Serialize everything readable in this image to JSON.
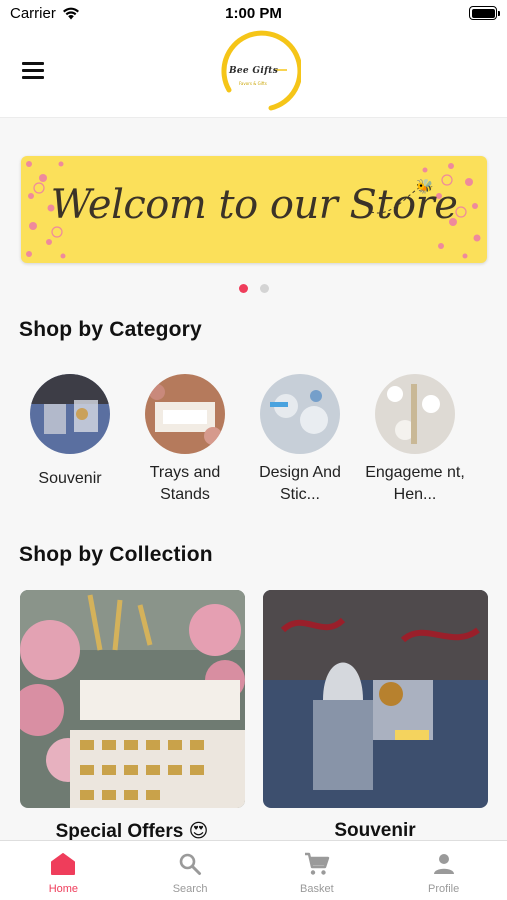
{
  "status_bar": {
    "carrier": "Carrier",
    "time": "1:00 PM"
  },
  "header": {
    "logo_text": "Bee Gifts"
  },
  "banner": {
    "text": "Welcom to our Store",
    "bg_color": "#fbe05a",
    "active_slide": 1,
    "slide_count": 2
  },
  "categories": {
    "title": "Shop by Category",
    "items": [
      {
        "label": "Souvenir"
      },
      {
        "label": "Trays and Stands"
      },
      {
        "label": "Design And Stic..."
      },
      {
        "label": "Engageme nt, Hen..."
      }
    ]
  },
  "collections": {
    "title": "Shop by Collection",
    "items": [
      {
        "label": "Special Offers 😍"
      },
      {
        "label": "Souvenir"
      }
    ]
  },
  "tabbar": {
    "items": [
      {
        "label": "Home",
        "icon": "home-icon",
        "active": true
      },
      {
        "label": "Search",
        "icon": "search-icon",
        "active": false
      },
      {
        "label": "Basket",
        "icon": "cart-icon",
        "active": false
      },
      {
        "label": "Profile",
        "icon": "profile-icon",
        "active": false
      }
    ]
  },
  "colors": {
    "accent": "#ef3d5b",
    "banner": "#fbe05a",
    "logo_ring": "#f5c518"
  }
}
